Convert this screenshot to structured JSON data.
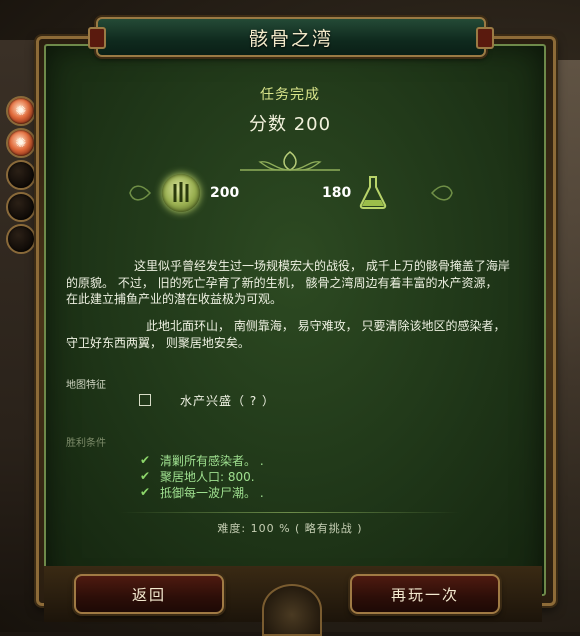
{
  "title": "骸骨之湾",
  "mission_status": "任务完成",
  "score": {
    "label": "分数",
    "value": "200"
  },
  "resources": [
    {
      "icon": "wood-icon",
      "value": "200"
    },
    {
      "icon": "flask-icon",
      "value": "180"
    }
  ],
  "description": {
    "para1": "这里似乎曾经发生过一场规模宏大的战役， 成千上万的骸骨掩盖了海岸的原貌。 不过， 旧的死亡孕育了新的生机， 骸骨之湾周边有着丰富的水产资源， 在此建立捕鱼产业的潜在收益极为可观。",
    "para2": "此地北面环山， 南侧靠海， 易守难攻， 只要清除该地区的感染者， 守卫好东西两翼， 则聚居地安矣。"
  },
  "map_features": {
    "label": "地图特征",
    "items": [
      "水产兴盛（ ? ）"
    ]
  },
  "victory": {
    "label": "胜利条件",
    "conditions": [
      "清剿所有感染者。 .",
      "聚居地人口: 800.",
      "抵御每一波尸潮。 ."
    ]
  },
  "difficulty": "难度: 100 % ( 略有挑战 )",
  "buttons": {
    "back": "返回",
    "play_again": "再玩一次"
  },
  "colors": {
    "panel_green": "#1f3618",
    "accent_gold": "#9a7a44",
    "check_green": "#8cd66a",
    "button_red": "#4e1a10"
  }
}
